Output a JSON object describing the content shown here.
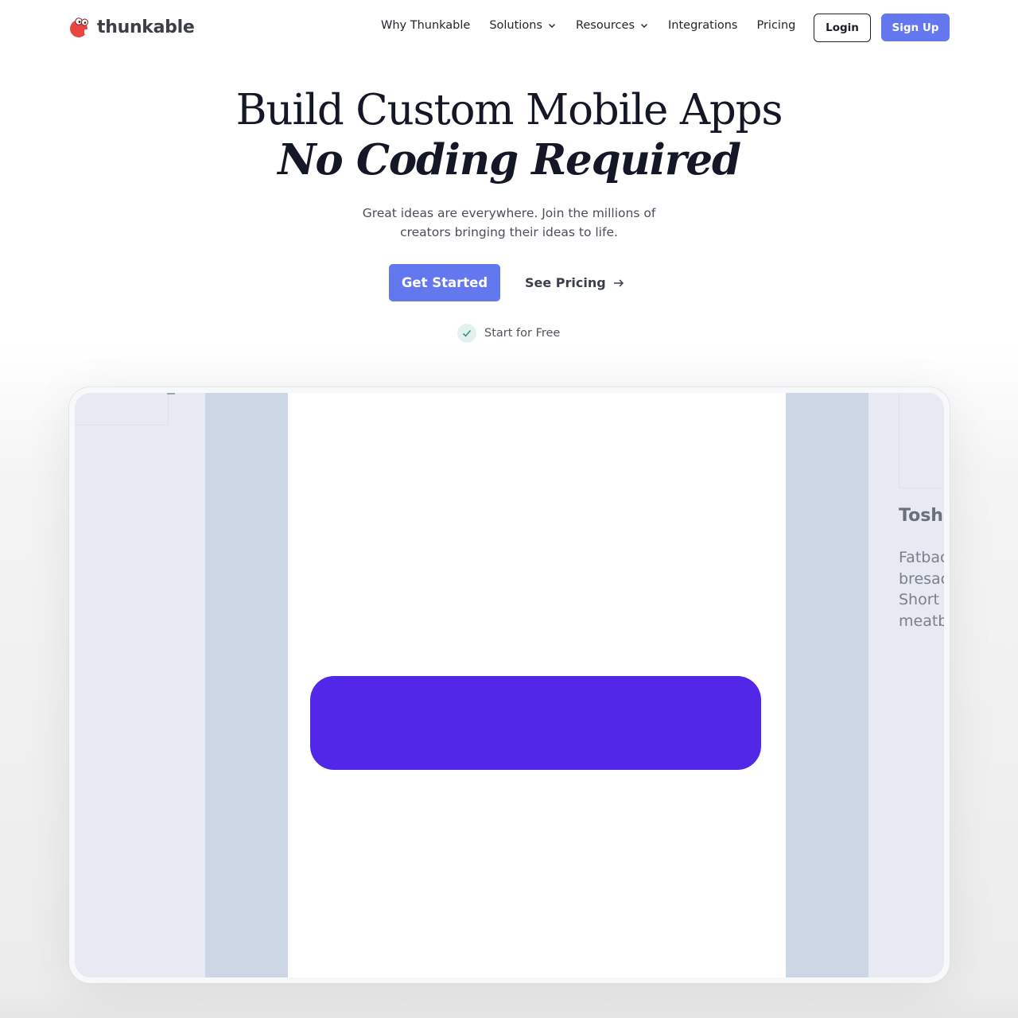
{
  "brand": {
    "name": "thunkable",
    "logo_icon": "thunkable-mascot-icon",
    "logo_color": "#e8473f"
  },
  "nav": {
    "items": [
      {
        "label": "Why Thunkable",
        "has_dropdown": false
      },
      {
        "label": "Solutions",
        "has_dropdown": true
      },
      {
        "label": "Resources",
        "has_dropdown": true
      },
      {
        "label": "Integrations",
        "has_dropdown": false
      },
      {
        "label": "Pricing",
        "has_dropdown": false
      }
    ],
    "login_label": "Login",
    "signup_label": "Sign Up"
  },
  "hero": {
    "title_line1": "Build Custom Mobile Apps",
    "title_line2": "No Coding Required",
    "subtitle_line1": "Great ideas are everywhere. Join the millions of",
    "subtitle_line2": "creators bringing their ideas to life.",
    "primary_cta": "Get Started",
    "secondary_cta": "See Pricing",
    "secondary_cta_icon": "arrow-right-icon",
    "free_note": "Start for Free",
    "free_note_icon": "check-icon"
  },
  "preview": {
    "card_title": "Tosh",
    "card_body_lines": [
      "Fatbac",
      "bresac",
      "Short",
      "meatb"
    ],
    "accent_button_color": "#5227e7"
  },
  "colors": {
    "primary": "#6378ee",
    "heading": "#141826",
    "check_green": "#2b9a7e"
  }
}
